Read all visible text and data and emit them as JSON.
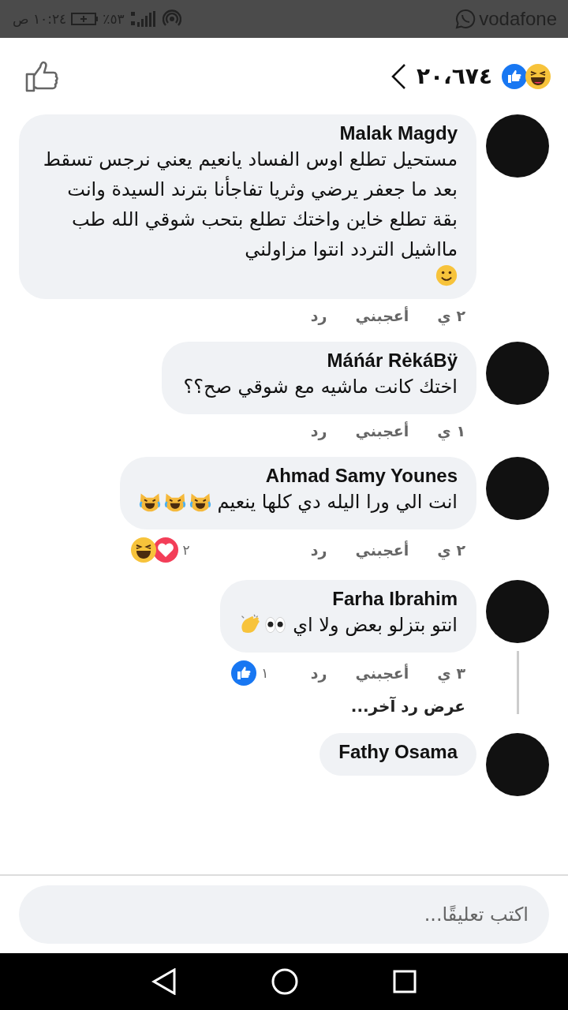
{
  "status_bar": {
    "carrier": "vodafone",
    "battery": "٪٥٣",
    "time": "١٠:٢٤ ص"
  },
  "header": {
    "reaction_count": "٢٠،٦٧٤"
  },
  "comments": [
    {
      "author": "Malak Magdy",
      "text": "مستحيل تطلع اوس الفساد يانعيم يعني نرجس تسقط بعد ما جعفر يرضي وثريا تفاجأنا بترند السيدة وانت بقة تطلع خاين واختك تطلع بتحب شوقي الله طب مااشيل التردد انتوا مزاولني",
      "emojis": [
        {
          "kind": "smile"
        }
      ],
      "time": "٢ ي",
      "like": "أعجبني",
      "reply": "رد"
    },
    {
      "author": "Máńár RėkáBÿ",
      "text": "اختك كانت ماشيه مع شوقي صح؟؟",
      "time": "١ ي",
      "like": "أعجبني",
      "reply": "رد"
    },
    {
      "author": "Ahmad Samy Younes",
      "text": "انت الي ورا اليله دي كلها ينعيم",
      "emojis": [
        {
          "kind": "cat"
        },
        {
          "kind": "cat"
        },
        {
          "kind": "cat"
        }
      ],
      "time": "٢ ي",
      "like": "أعجبني",
      "reply": "رد",
      "reactions": {
        "count": "٢",
        "icons": [
          {
            "kind": "love"
          },
          {
            "kind": "haha"
          }
        ]
      }
    },
    {
      "author": "Farha Ibrahim",
      "text": "انتو بتزلو بعض ولا اي",
      "emojis": [
        {
          "kind": "eyes"
        },
        {
          "kind": "clap"
        }
      ],
      "time": "٣ ي",
      "like": "أعجبني",
      "reply": "رد",
      "reactions": {
        "count": "١",
        "icons": [
          {
            "kind": "like"
          }
        ]
      },
      "more_replies": "عرض رد آخر..."
    },
    {
      "author": "Fathy Osama"
    }
  ],
  "composer": {
    "placeholder": "اكتب تعليقًا..."
  }
}
